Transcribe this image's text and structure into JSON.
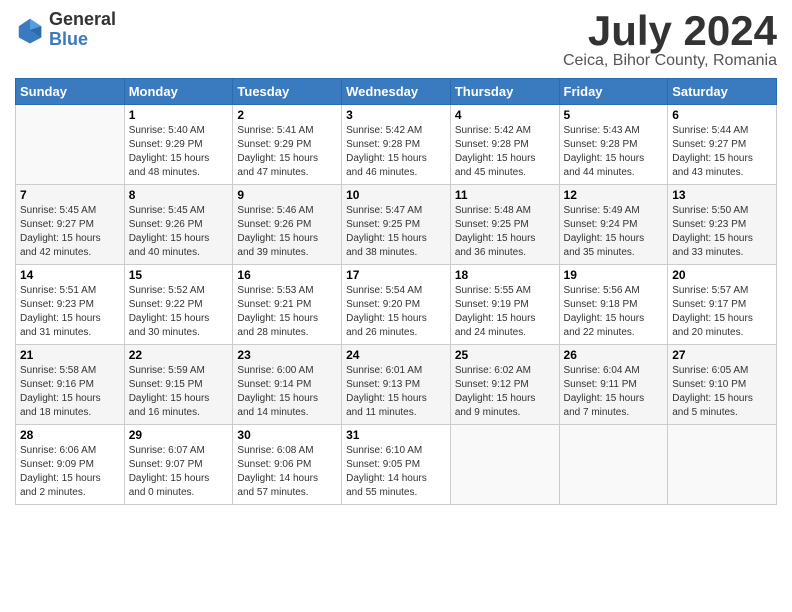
{
  "logo": {
    "general": "General",
    "blue": "Blue"
  },
  "title": "July 2024",
  "subtitle": "Ceica, Bihor County, Romania",
  "headers": [
    "Sunday",
    "Monday",
    "Tuesday",
    "Wednesday",
    "Thursday",
    "Friday",
    "Saturday"
  ],
  "weeks": [
    [
      {
        "day": "",
        "info": ""
      },
      {
        "day": "1",
        "info": "Sunrise: 5:40 AM\nSunset: 9:29 PM\nDaylight: 15 hours\nand 48 minutes."
      },
      {
        "day": "2",
        "info": "Sunrise: 5:41 AM\nSunset: 9:29 PM\nDaylight: 15 hours\nand 47 minutes."
      },
      {
        "day": "3",
        "info": "Sunrise: 5:42 AM\nSunset: 9:28 PM\nDaylight: 15 hours\nand 46 minutes."
      },
      {
        "day": "4",
        "info": "Sunrise: 5:42 AM\nSunset: 9:28 PM\nDaylight: 15 hours\nand 45 minutes."
      },
      {
        "day": "5",
        "info": "Sunrise: 5:43 AM\nSunset: 9:28 PM\nDaylight: 15 hours\nand 44 minutes."
      },
      {
        "day": "6",
        "info": "Sunrise: 5:44 AM\nSunset: 9:27 PM\nDaylight: 15 hours\nand 43 minutes."
      }
    ],
    [
      {
        "day": "7",
        "info": "Sunrise: 5:45 AM\nSunset: 9:27 PM\nDaylight: 15 hours\nand 42 minutes."
      },
      {
        "day": "8",
        "info": "Sunrise: 5:45 AM\nSunset: 9:26 PM\nDaylight: 15 hours\nand 40 minutes."
      },
      {
        "day": "9",
        "info": "Sunrise: 5:46 AM\nSunset: 9:26 PM\nDaylight: 15 hours\nand 39 minutes."
      },
      {
        "day": "10",
        "info": "Sunrise: 5:47 AM\nSunset: 9:25 PM\nDaylight: 15 hours\nand 38 minutes."
      },
      {
        "day": "11",
        "info": "Sunrise: 5:48 AM\nSunset: 9:25 PM\nDaylight: 15 hours\nand 36 minutes."
      },
      {
        "day": "12",
        "info": "Sunrise: 5:49 AM\nSunset: 9:24 PM\nDaylight: 15 hours\nand 35 minutes."
      },
      {
        "day": "13",
        "info": "Sunrise: 5:50 AM\nSunset: 9:23 PM\nDaylight: 15 hours\nand 33 minutes."
      }
    ],
    [
      {
        "day": "14",
        "info": "Sunrise: 5:51 AM\nSunset: 9:23 PM\nDaylight: 15 hours\nand 31 minutes."
      },
      {
        "day": "15",
        "info": "Sunrise: 5:52 AM\nSunset: 9:22 PM\nDaylight: 15 hours\nand 30 minutes."
      },
      {
        "day": "16",
        "info": "Sunrise: 5:53 AM\nSunset: 9:21 PM\nDaylight: 15 hours\nand 28 minutes."
      },
      {
        "day": "17",
        "info": "Sunrise: 5:54 AM\nSunset: 9:20 PM\nDaylight: 15 hours\nand 26 minutes."
      },
      {
        "day": "18",
        "info": "Sunrise: 5:55 AM\nSunset: 9:19 PM\nDaylight: 15 hours\nand 24 minutes."
      },
      {
        "day": "19",
        "info": "Sunrise: 5:56 AM\nSunset: 9:18 PM\nDaylight: 15 hours\nand 22 minutes."
      },
      {
        "day": "20",
        "info": "Sunrise: 5:57 AM\nSunset: 9:17 PM\nDaylight: 15 hours\nand 20 minutes."
      }
    ],
    [
      {
        "day": "21",
        "info": "Sunrise: 5:58 AM\nSunset: 9:16 PM\nDaylight: 15 hours\nand 18 minutes."
      },
      {
        "day": "22",
        "info": "Sunrise: 5:59 AM\nSunset: 9:15 PM\nDaylight: 15 hours\nand 16 minutes."
      },
      {
        "day": "23",
        "info": "Sunrise: 6:00 AM\nSunset: 9:14 PM\nDaylight: 15 hours\nand 14 minutes."
      },
      {
        "day": "24",
        "info": "Sunrise: 6:01 AM\nSunset: 9:13 PM\nDaylight: 15 hours\nand 11 minutes."
      },
      {
        "day": "25",
        "info": "Sunrise: 6:02 AM\nSunset: 9:12 PM\nDaylight: 15 hours\nand 9 minutes."
      },
      {
        "day": "26",
        "info": "Sunrise: 6:04 AM\nSunset: 9:11 PM\nDaylight: 15 hours\nand 7 minutes."
      },
      {
        "day": "27",
        "info": "Sunrise: 6:05 AM\nSunset: 9:10 PM\nDaylight: 15 hours\nand 5 minutes."
      }
    ],
    [
      {
        "day": "28",
        "info": "Sunrise: 6:06 AM\nSunset: 9:09 PM\nDaylight: 15 hours\nand 2 minutes."
      },
      {
        "day": "29",
        "info": "Sunrise: 6:07 AM\nSunset: 9:07 PM\nDaylight: 15 hours\nand 0 minutes."
      },
      {
        "day": "30",
        "info": "Sunrise: 6:08 AM\nSunset: 9:06 PM\nDaylight: 14 hours\nand 57 minutes."
      },
      {
        "day": "31",
        "info": "Sunrise: 6:10 AM\nSunset: 9:05 PM\nDaylight: 14 hours\nand 55 minutes."
      },
      {
        "day": "",
        "info": ""
      },
      {
        "day": "",
        "info": ""
      },
      {
        "day": "",
        "info": ""
      }
    ]
  ]
}
